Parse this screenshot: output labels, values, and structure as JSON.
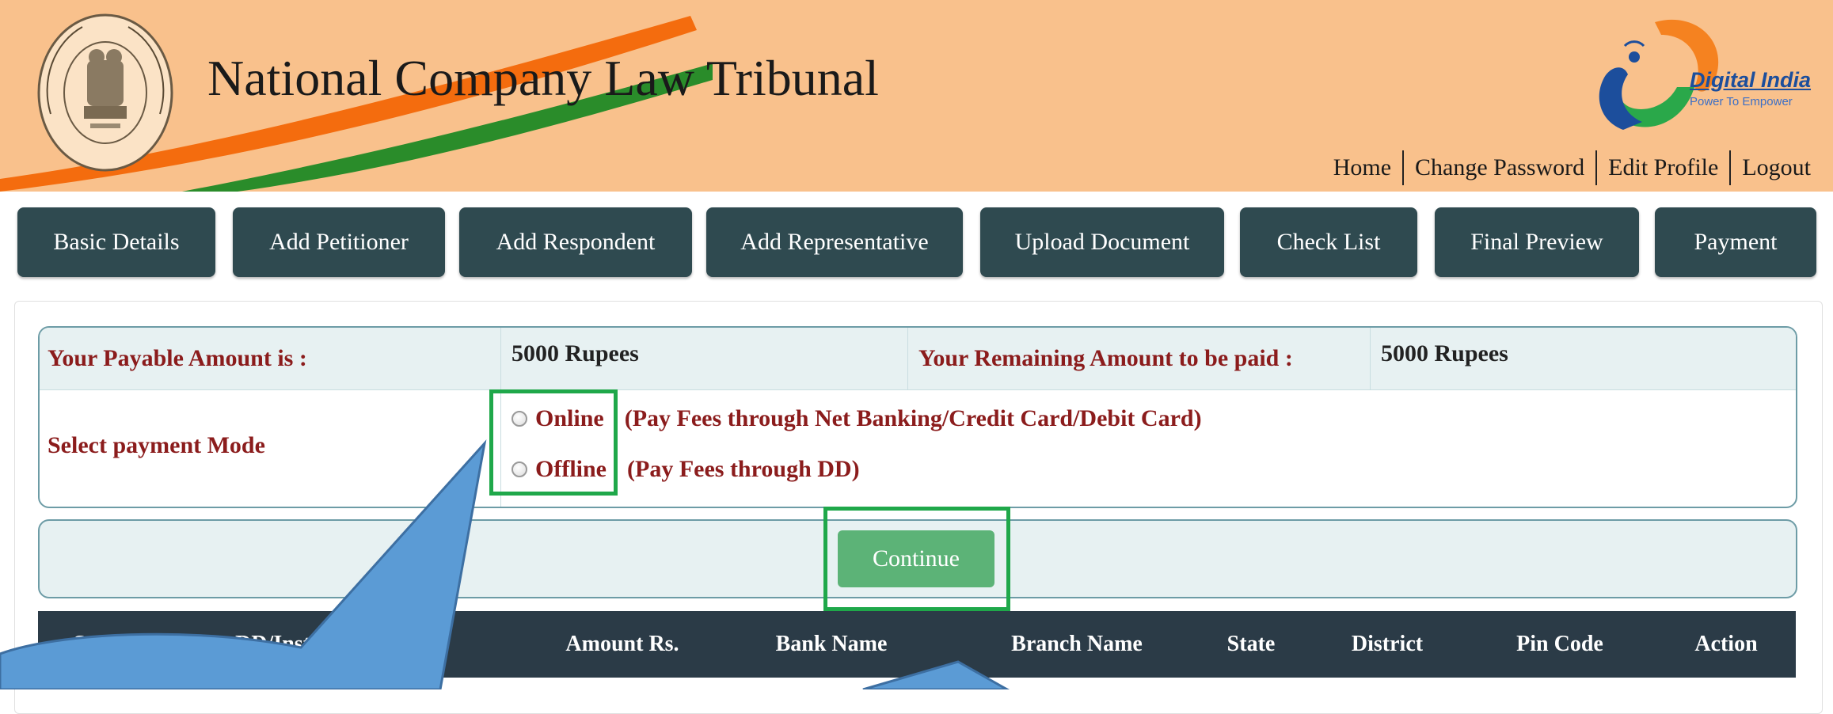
{
  "header": {
    "title": "National Company Law Tribunal",
    "seal_text": "National Company Law Tribunal",
    "digital_india_name": "Digital India",
    "digital_india_tagline": "Power To Empower"
  },
  "top_nav": [
    "Home",
    "Change Password",
    "Edit Profile",
    "Logout"
  ],
  "steps": [
    "Basic Details",
    "Add Petitioner",
    "Add Respondent",
    "Add Representative",
    "Upload Document",
    "Check List",
    "Final Preview",
    "Payment"
  ],
  "payment": {
    "payable_label": "Your Payable Amount is :",
    "payable_value": "5000 Rupees",
    "remaining_label": "Your Remaining Amount to be paid :",
    "remaining_value": "5000 Rupees",
    "mode_label": "Select payment Mode",
    "options": [
      {
        "name": "Online",
        "desc": "(Pay Fees through Net Banking/Credit Card/Debit Card)"
      },
      {
        "name": "Offline",
        "desc": "(Pay Fees through DD)"
      }
    ]
  },
  "continue_label": "Continue",
  "table_headers": [
    "S. No.",
    "DD/Instrument No.",
    "Amount Rs.",
    "Bank Name",
    "Branch Name",
    "State",
    "District",
    "Pin Code",
    "Action"
  ],
  "colors": {
    "header_bg": "#f9c18c",
    "step_button": "#2f4a50",
    "label_red": "#8b1c1c",
    "highlight_green": "#1fa84a",
    "continue_green": "#5cb377",
    "table_head": "#2b3b47",
    "callout_blue": "#5b9bd5"
  }
}
